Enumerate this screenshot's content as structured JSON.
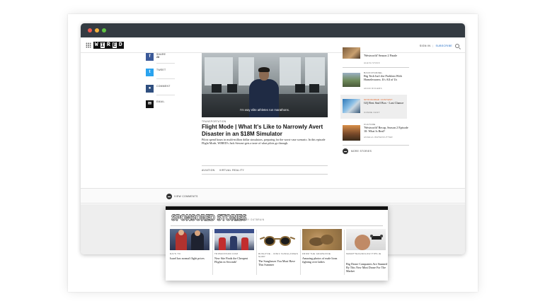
{
  "header": {
    "logo": [
      "W",
      "I",
      "R",
      "E",
      "D"
    ],
    "signin": "SIGN IN",
    "divider": "|",
    "subscribe": "SUBSCRIBE"
  },
  "share": [
    {
      "icon": "facebook-icon",
      "glyph": "f",
      "label": "SHARE",
      "count": "28",
      "color": "#3b5998"
    },
    {
      "icon": "twitter-icon",
      "glyph": "t",
      "label": "TWEET",
      "count": "",
      "color": "#2aa3ef"
    },
    {
      "icon": "comment-icon",
      "glyph": "●",
      "label": "COMMENT",
      "count": "",
      "color": "#2f4f7f"
    },
    {
      "icon": "email-icon",
      "glyph": "✉",
      "label": "EMAIL",
      "count": "",
      "color": "#111111"
    }
  ],
  "article": {
    "video_caption": "I'm way elite athletes run marathons.",
    "category": "TRANSPORTATION",
    "headline": "Flight Mode | What It's Like to Narrowly Avert Disaster in an $18M Simulator",
    "dek": "Pilots spend hours in multi-million dollar simulators, preparing for the worst-case scenario. In this episode Flight Mode, WIRED's Jack Stewart gets a taste of what pilots go through.",
    "tags": [
      "AVIATION",
      "VIRTUAL REALITY"
    ]
  },
  "rail": [
    {
      "category": "",
      "title": "'Westworld' Season 2 Finale",
      "author": "ALEXA STAFF",
      "sponsored": false
    },
    {
      "category": "BACKCHANNEL",
      "title": "Big Tech Isn't the Problem With Homelessness. It's All of Us",
      "author": "ADAM ROGERS",
      "sponsored": false
    },
    {
      "category": "SPONSORED CONTENT",
      "title": "GQ Best Stuff Box - Last Chance",
      "author": "CONDE NAST",
      "sponsored": true
    },
    {
      "category": "CULTURE",
      "title": "'Westworld' Recap, Season 2 Episode 10: What Is Real?",
      "author": "ANGELA WATERCUTTER",
      "sponsored": false
    }
  ],
  "more_stories": "MORE STORIES",
  "view_comments": "VIEW COMMENTS",
  "sponsored": {
    "title": "SPONSORED STORIES",
    "powered_by": "POWERED BY OUTBRAIN",
    "cards": [
      {
        "source": "DAYS TO",
        "title": "Israel has normal flight prices"
      },
      {
        "source": "TRIPADVISOR.COM",
        "title": "New Site Finds the Cheapest Flights in Seconds!"
      },
      {
        "source": "RUSHYOE - IONIC SUNGLASSES SHOP",
        "title": "The Sunglasses You Must Have This Summer"
      },
      {
        "source": "FROM THE GRAPEVINE",
        "title": "Amazing photos of male lions fighting over ladies"
      },
      {
        "source": "SMARTTECHNOLOGYTIPS.IE",
        "title": "Big Drone Companies Are Stunned By This New Mini Drone For The Market"
      }
    ]
  }
}
